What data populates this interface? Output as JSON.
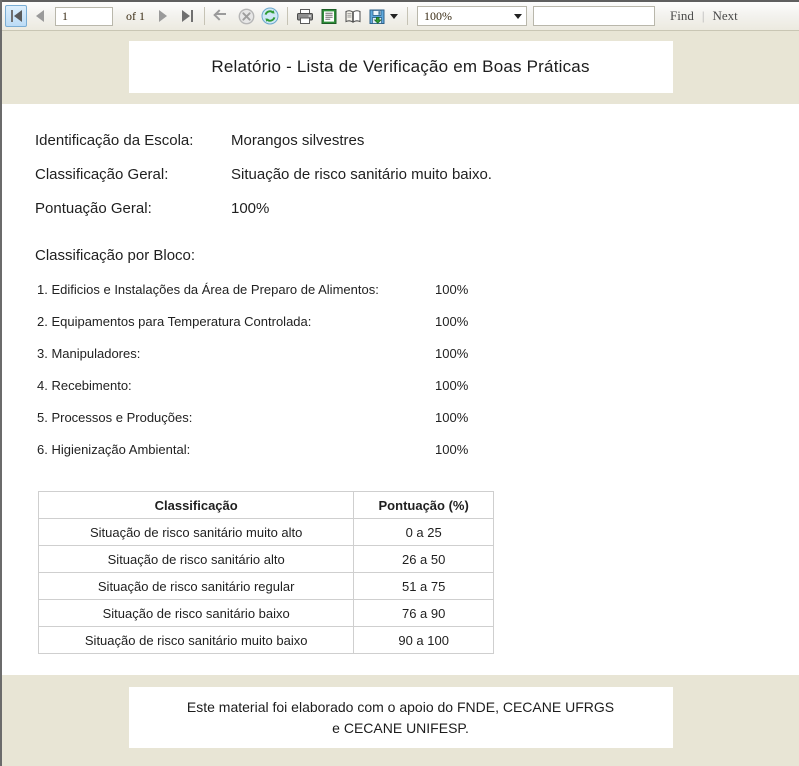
{
  "toolbar": {
    "first_page_label": "first-page",
    "prev_page_label": "previous-page",
    "page_number": "1",
    "of_label": "of 1",
    "next_page_label": "next-page",
    "last_page_label": "last-page",
    "back_label": "back",
    "stop_label": "stop",
    "refresh_label": "refresh",
    "print_label": "print",
    "print_layout_label": "print-layout",
    "page_setup_label": "page-setup",
    "export_label": "export",
    "zoom_value": "100%",
    "find_value": "",
    "find_placeholder": "",
    "find_label": "Find",
    "separator": "|",
    "next_label": "Next"
  },
  "report": {
    "title": "Relatório - Lista de Verificação em Boas Práticas",
    "identification": [
      {
        "label": "Identificação da Escola:",
        "value": "Morangos silvestres"
      },
      {
        "label": "Classificação Geral:",
        "value": "Situação de risco sanitário muito baixo."
      },
      {
        "label": "Pontuação Geral:",
        "value": "100%"
      }
    ],
    "blocks_heading": "Classificação por Bloco:",
    "blocks": [
      {
        "name": "1. Edificios e Instalações da Área de Preparo de Alimentos:",
        "score": "100%"
      },
      {
        "name": "2. Equipamentos para Temperatura Controlada:",
        "score": "100%"
      },
      {
        "name": "3. Manipuladores:",
        "score": "100%"
      },
      {
        "name": "4. Recebimento:",
        "score": "100%"
      },
      {
        "name": "5. Processos e Produções:",
        "score": "100%"
      },
      {
        "name": "6. Higienização Ambiental:",
        "score": "100%"
      }
    ],
    "table": {
      "headers": {
        "classification": "Classificação",
        "score": "Pontuação (%)"
      },
      "rows": [
        {
          "classification": "Situação de risco sanitário muito alto",
          "score": "0 a 25"
        },
        {
          "classification": "Situação de risco sanitário alto",
          "score": "26 a 50"
        },
        {
          "classification": "Situação de risco sanitário regular",
          "score": "51 a 75"
        },
        {
          "classification": "Situação de risco sanitário baixo",
          "score": "76 a 90"
        },
        {
          "classification": "Situação de risco sanitário muito baixo",
          "score": "90 a 100"
        }
      ]
    },
    "footer_line1": "Este material foi elaborado com o apoio do FNDE, CECANE UFRGS",
    "footer_line2": "e CECANE UNIFESP."
  },
  "colors": {
    "band": "#e8e5d5",
    "page": "#ffffff",
    "toolbar_text": "#3b2d16",
    "table_border": "#cfcfcf",
    "active_button": "#bcdcf6"
  }
}
